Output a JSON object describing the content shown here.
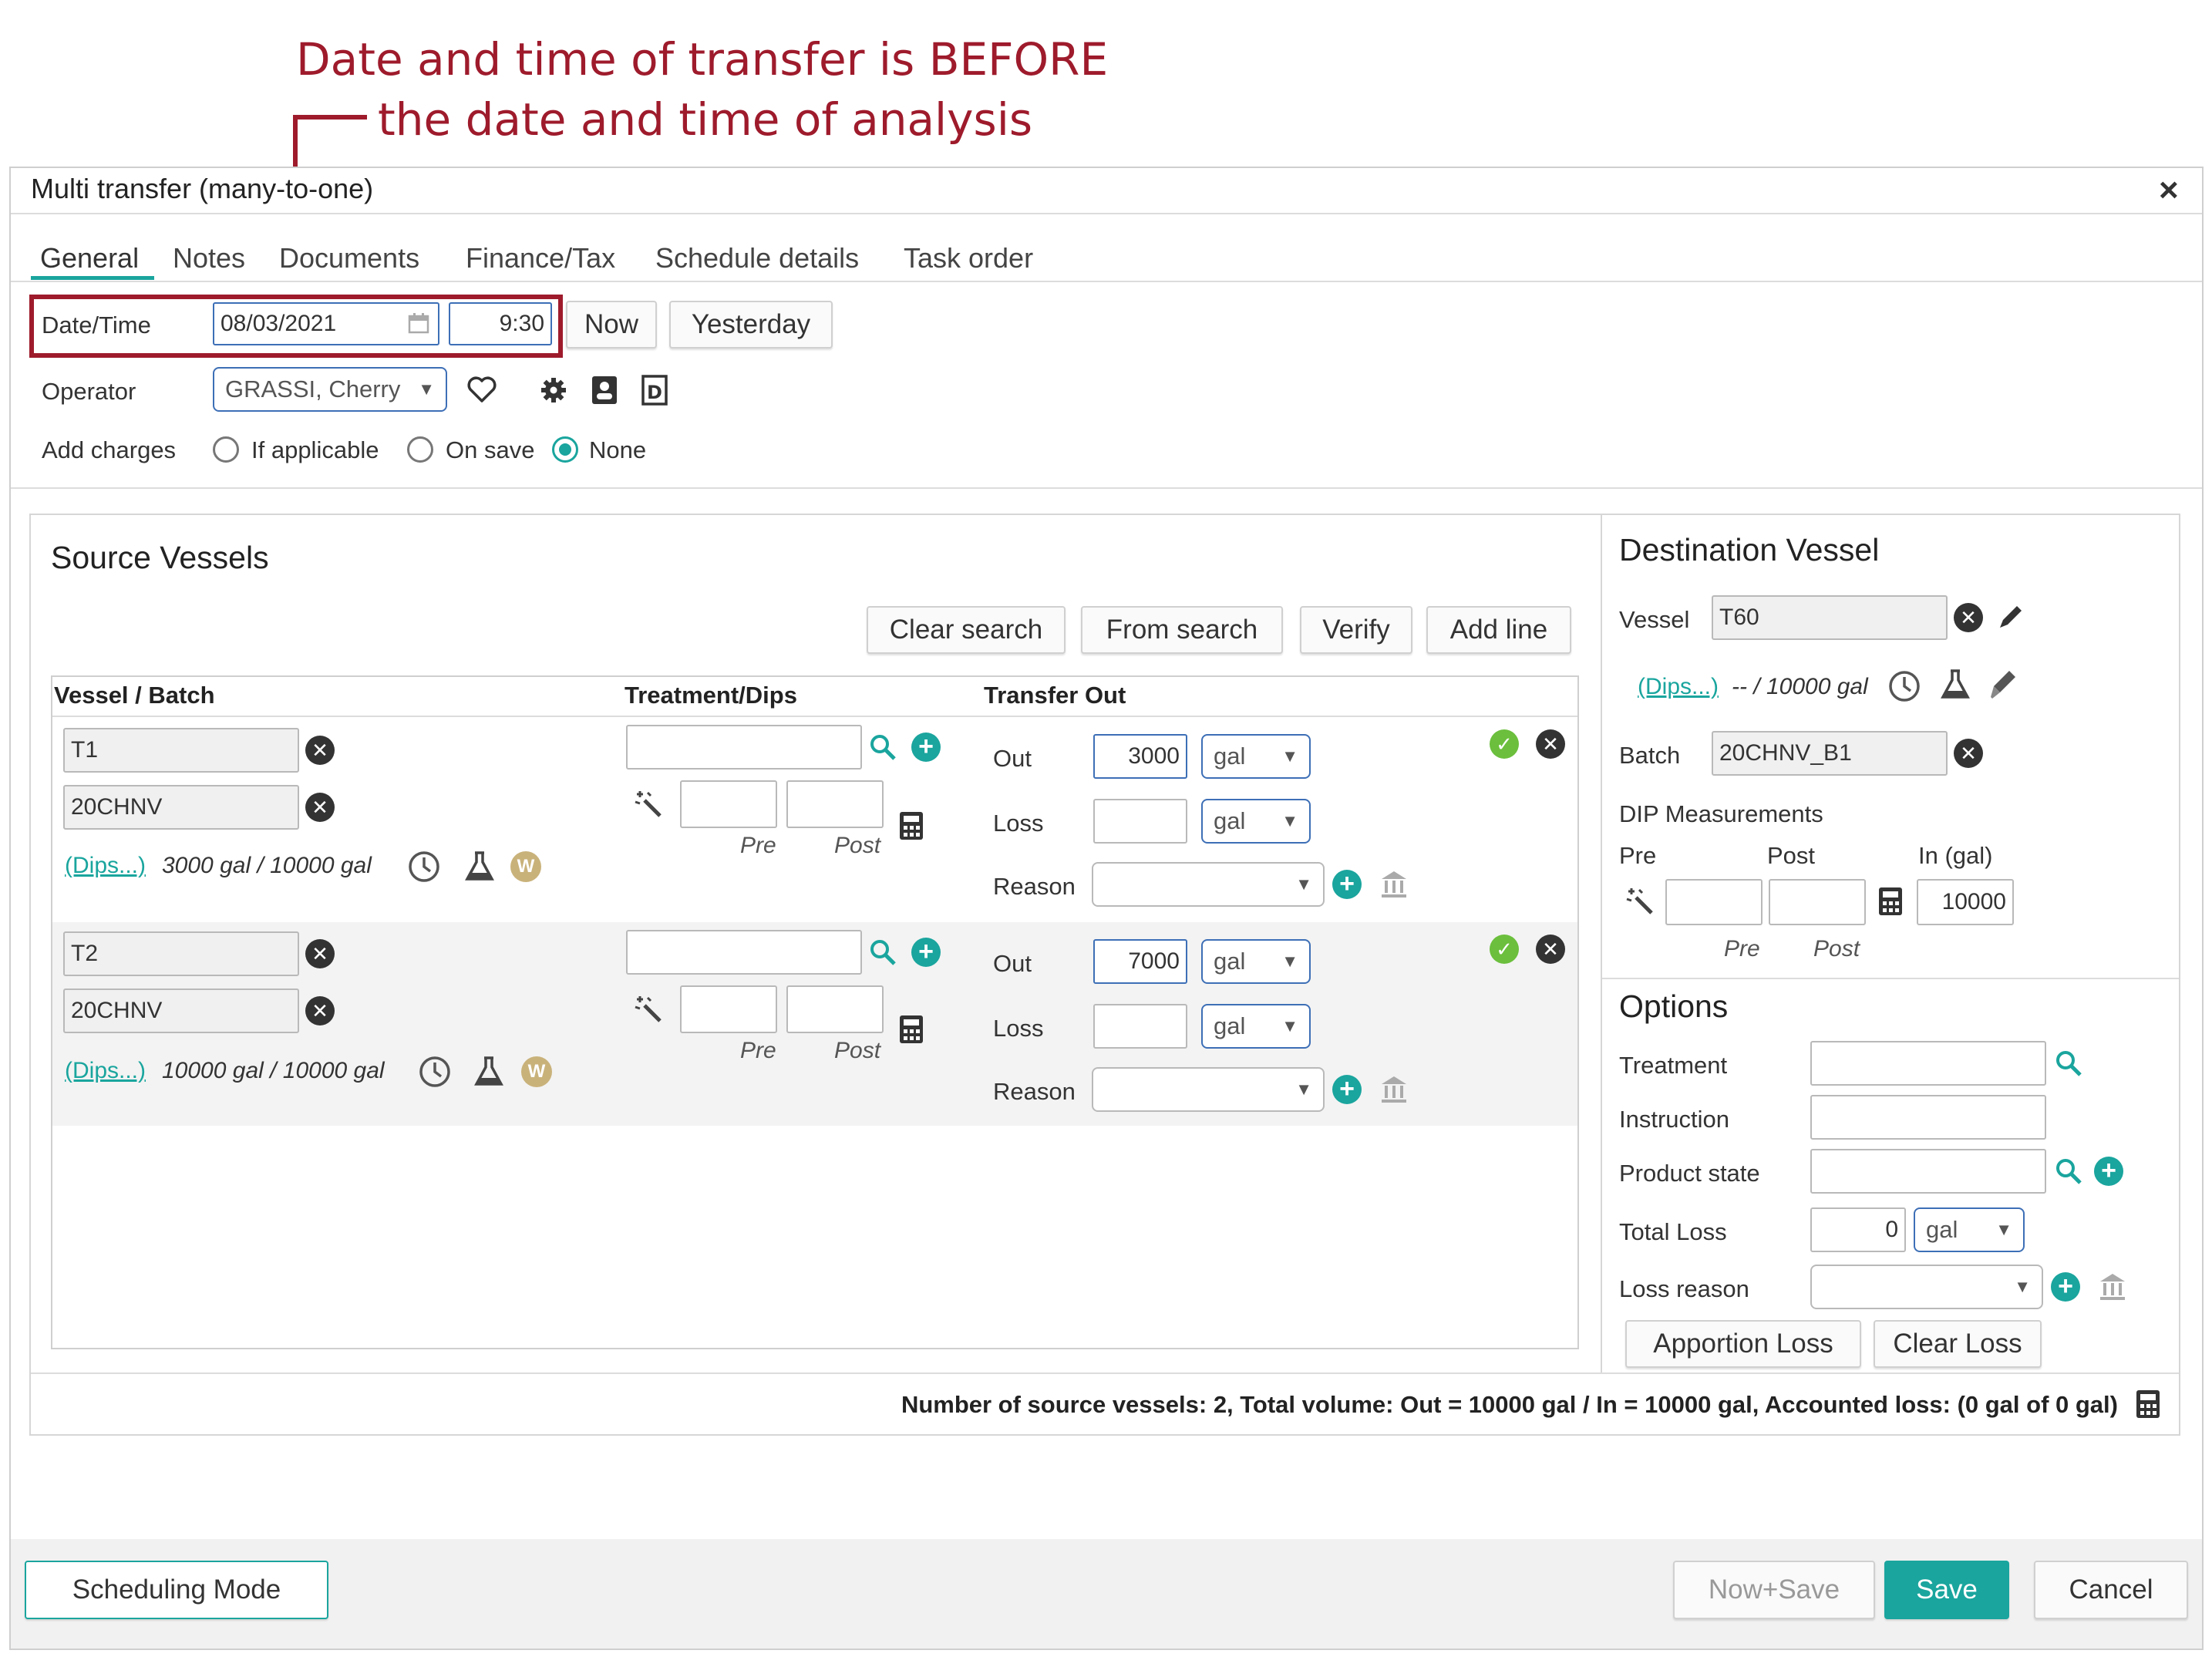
{
  "annotation": {
    "line1": "Date and time of transfer is BEFORE",
    "line2": "the date and time of analysis"
  },
  "dialog": {
    "title": "Multi transfer (many-to-one)",
    "close_label": "×"
  },
  "tabs": [
    "General",
    "Notes",
    "Documents",
    "Finance/Tax",
    "Schedule details",
    "Task order"
  ],
  "general": {
    "datetime_label": "Date/Time",
    "date_value": "08/03/2021",
    "time_value": "9:30",
    "now_label": "Now",
    "yesterday_label": "Yesterday",
    "operator_label": "Operator",
    "operator_value": "GRASSI, Cherry",
    "add_charges_label": "Add charges",
    "charges_options": [
      "If applicable",
      "On save",
      "None"
    ],
    "charges_selected": "None"
  },
  "source": {
    "title": "Source Vessels",
    "buttons": {
      "clear_search": "Clear search",
      "from_search": "From search",
      "verify": "Verify",
      "add_line": "Add line"
    },
    "columns": [
      "Vessel / Batch",
      "Treatment/Dips",
      "Transfer Out"
    ],
    "rows": [
      {
        "vessel": "T1",
        "batch": "20CHNV",
        "dips_link": "(Dips...)",
        "volume_text": "3000 gal / 10000 gal",
        "pre_label": "Pre",
        "post_label": "Post",
        "out_label": "Out",
        "out_value": "3000",
        "out_unit": "gal",
        "loss_label": "Loss",
        "loss_unit": "gal",
        "reason_label": "Reason",
        "w_badge": "W"
      },
      {
        "vessel": "T2",
        "batch": "20CHNV",
        "dips_link": "(Dips...)",
        "volume_text": "10000 gal / 10000 gal",
        "pre_label": "Pre",
        "post_label": "Post",
        "out_label": "Out",
        "out_value": "7000",
        "out_unit": "gal",
        "loss_label": "Loss",
        "loss_unit": "gal",
        "reason_label": "Reason",
        "w_badge": "W"
      }
    ]
  },
  "destination": {
    "title": "Destination Vessel",
    "vessel_label": "Vessel",
    "vessel_value": "T60",
    "dips_link": "(Dips...)",
    "volume_text": "-- / 10000 gal",
    "batch_label": "Batch",
    "batch_value": "20CHNV_B1",
    "dip_label": "DIP Measurements",
    "pre_head": "Pre",
    "post_head": "Post",
    "in_head": "In (gal)",
    "in_value": "10000",
    "pre_label": "Pre",
    "post_label": "Post"
  },
  "options": {
    "title": "Options",
    "treatment_label": "Treatment",
    "instruction_label": "Instruction",
    "product_state_label": "Product state",
    "total_loss_label": "Total Loss",
    "total_loss_value": "0",
    "total_loss_unit": "gal",
    "loss_reason_label": "Loss reason",
    "apportion_label": "Apportion Loss",
    "clear_loss_label": "Clear Loss"
  },
  "summary": "Number of source vessels: 2, Total volume: Out = 10000 gal / In = 10000 gal, Accounted loss: (0 gal of 0 gal)",
  "footer": {
    "scheduling_mode": "Scheduling Mode",
    "now_save": "Now+Save",
    "save": "Save",
    "cancel": "Cancel"
  },
  "colors": {
    "accent": "#1aa59e",
    "annotation": "#9e1b2c",
    "input_border": "#3d6fb6"
  }
}
